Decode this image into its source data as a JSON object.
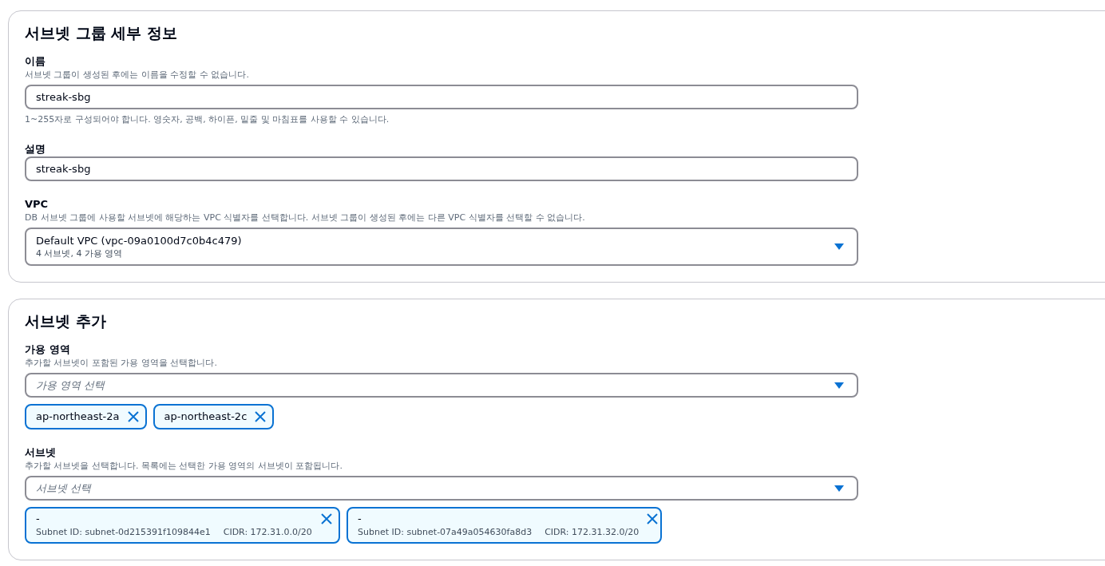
{
  "sections": [
    {
      "title": "서브넷 그룹 세부 정보",
      "fields": [
        {
          "kind": "input",
          "label": "이름",
          "description": "서브넷 그룹이 생성된 후에는 이름을 수정할 수 없습니다.",
          "value": "streak-sbg",
          "constraint": "1~255자로 구성되어야 합니다. 영숫자, 공백, 하이픈, 밑줄 및 마침표를 사용할 수 있습니다."
        },
        {
          "kind": "input",
          "label": "설명",
          "value": "streak-sbg"
        },
        {
          "kind": "select",
          "label": "VPC",
          "description": "DB 서브넷 그룹에 사용할 서브넷에 해당하는 VPC 식별자를 선택합니다. 서브넷 그룹이 생성된 후에는 다른 VPC 식별자를 선택할 수 없습니다.",
          "value": "Default VPC (vpc-09a0100d7c0b4c479)",
          "secondary": "4 서브넷, 4 가용 영역"
        }
      ]
    },
    {
      "title": "서브넷 추가",
      "fields": [
        {
          "kind": "multiselect",
          "label": "가용 영역",
          "description": "추가할 서브넷이 포함된 가용 영역을 선택합니다.",
          "placeholder": "가용 영역 선택",
          "tokens": [
            {
              "label": "ap-northeast-2a"
            },
            {
              "label": "ap-northeast-2c"
            }
          ]
        },
        {
          "kind": "multiselect",
          "label": "서브넷",
          "description": "추가할 서브넷을 선택합니다. 목록에는 선택한 가용 영역의 서브넷이 포함됩니다.",
          "placeholder": "서브넷 선택",
          "tokens": [
            {
              "label": "-",
              "details": [
                "Subnet ID: subnet-0d215391f109844e1",
                "CIDR: 172.31.0.0/20"
              ]
            },
            {
              "label": "-",
              "details": [
                "Subnet ID: subnet-07a49a054630fa8d3",
                "CIDR: 172.31.32.0/20"
              ]
            }
          ]
        }
      ]
    }
  ]
}
